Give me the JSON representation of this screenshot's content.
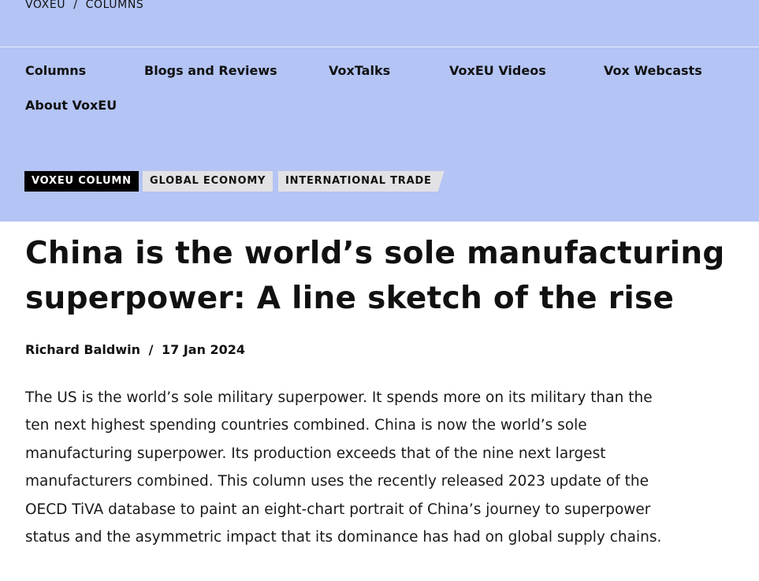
{
  "breadcrumb": {
    "site": "VOXEU",
    "separator": "/",
    "section": "COLUMNS"
  },
  "nav": {
    "items": [
      {
        "label": "Columns"
      },
      {
        "label": "Blogs and Reviews"
      },
      {
        "label": "VoxTalks"
      },
      {
        "label": "VoxEU Videos"
      },
      {
        "label": "Vox Webcasts"
      },
      {
        "label": "About VoxEU"
      }
    ]
  },
  "tags": [
    {
      "label": "VOXEU COLUMN"
    },
    {
      "label": "GLOBAL ECONOMY"
    },
    {
      "label": "INTERNATIONAL TRADE"
    }
  ],
  "article": {
    "title": "China is the world’s sole manufacturing superpower: A line sketch of the rise",
    "author": "Richard Baldwin",
    "byline_separator": "/",
    "date": "17 Jan 2024",
    "lead": "The US is the world’s sole military superpower. It spends more on its military than the ten next highest spending countries combined. China is now the world’s sole manufacturing superpower. Its production exceeds that of the nine next largest manufacturers combined. This column uses the recently released 2023 update of the OECD TiVA database to paint an eight-chart portrait of China’s journey to superpower status and the asymmetric impact that its dominance has had on global supply chains."
  },
  "colors": {
    "header_bg": "#b3c4f5",
    "tag_primary_bg": "#000000",
    "tag_secondary_bg": "#e2e2e4",
    "text": "#111111"
  }
}
